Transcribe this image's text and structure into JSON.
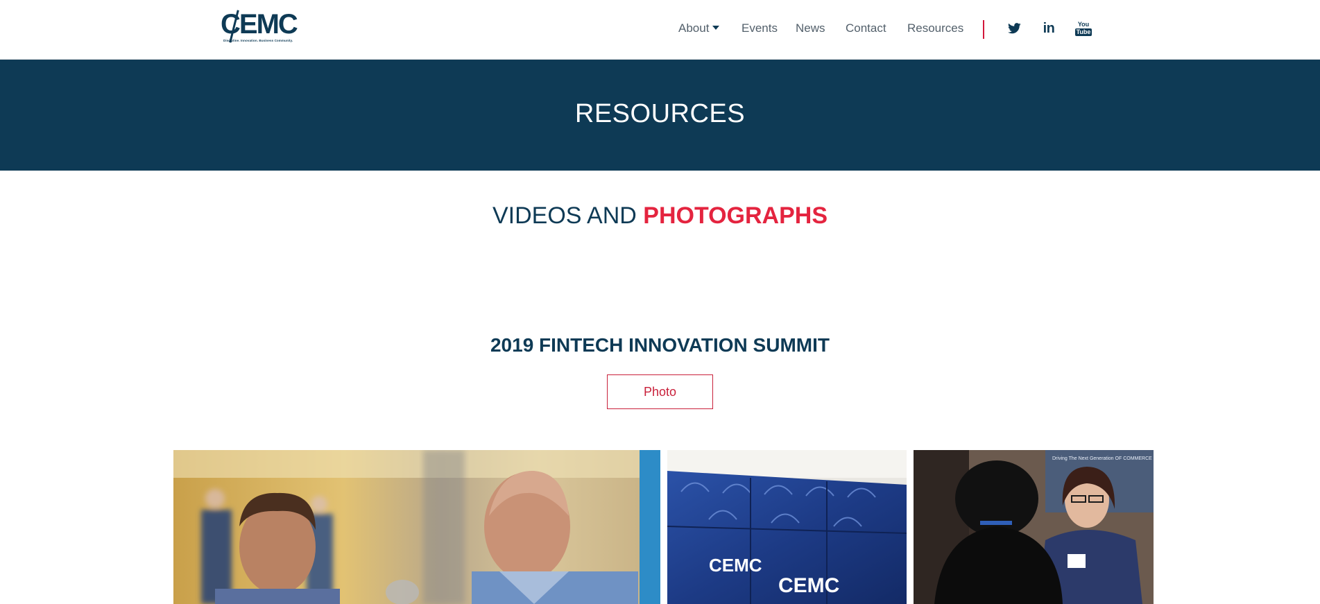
{
  "header": {
    "logo": {
      "name": "CEMC",
      "tagline": "Discipline. Innovation. Business Community."
    },
    "nav": [
      {
        "label": "About",
        "has_dropdown": true
      },
      {
        "label": "Events"
      },
      {
        "label": "News"
      },
      {
        "label": "Contact"
      },
      {
        "label": "Resources"
      }
    ],
    "social": [
      {
        "icon": "twitter-icon"
      },
      {
        "icon": "linkedin-icon",
        "glyph": "in"
      },
      {
        "icon": "youtube-icon",
        "glyph_top": "You",
        "glyph_bottom": "Tube"
      }
    ]
  },
  "banner": {
    "title": "RESOURCES"
  },
  "section": {
    "heading_main": "VIDEOS AND",
    "heading_accent": "PHOTOGRAPHS"
  },
  "event": {
    "title": "2019 FINTECH INNOVATION SUMMIT",
    "button_label": "Photo"
  },
  "gallery": {
    "photos": [
      {
        "subject": "two men talking at event"
      },
      {
        "subject": "branded gift bags",
        "bag_brand": "CEMC"
      },
      {
        "subject": "woman greeting attendee",
        "screen_text": "Driving The Next Generation OF COMMERCE"
      }
    ]
  },
  "colors": {
    "navy": "#0e3a55",
    "accent_red": "#e4243f",
    "button_red": "#c9203a",
    "nav_text": "#53606b"
  }
}
